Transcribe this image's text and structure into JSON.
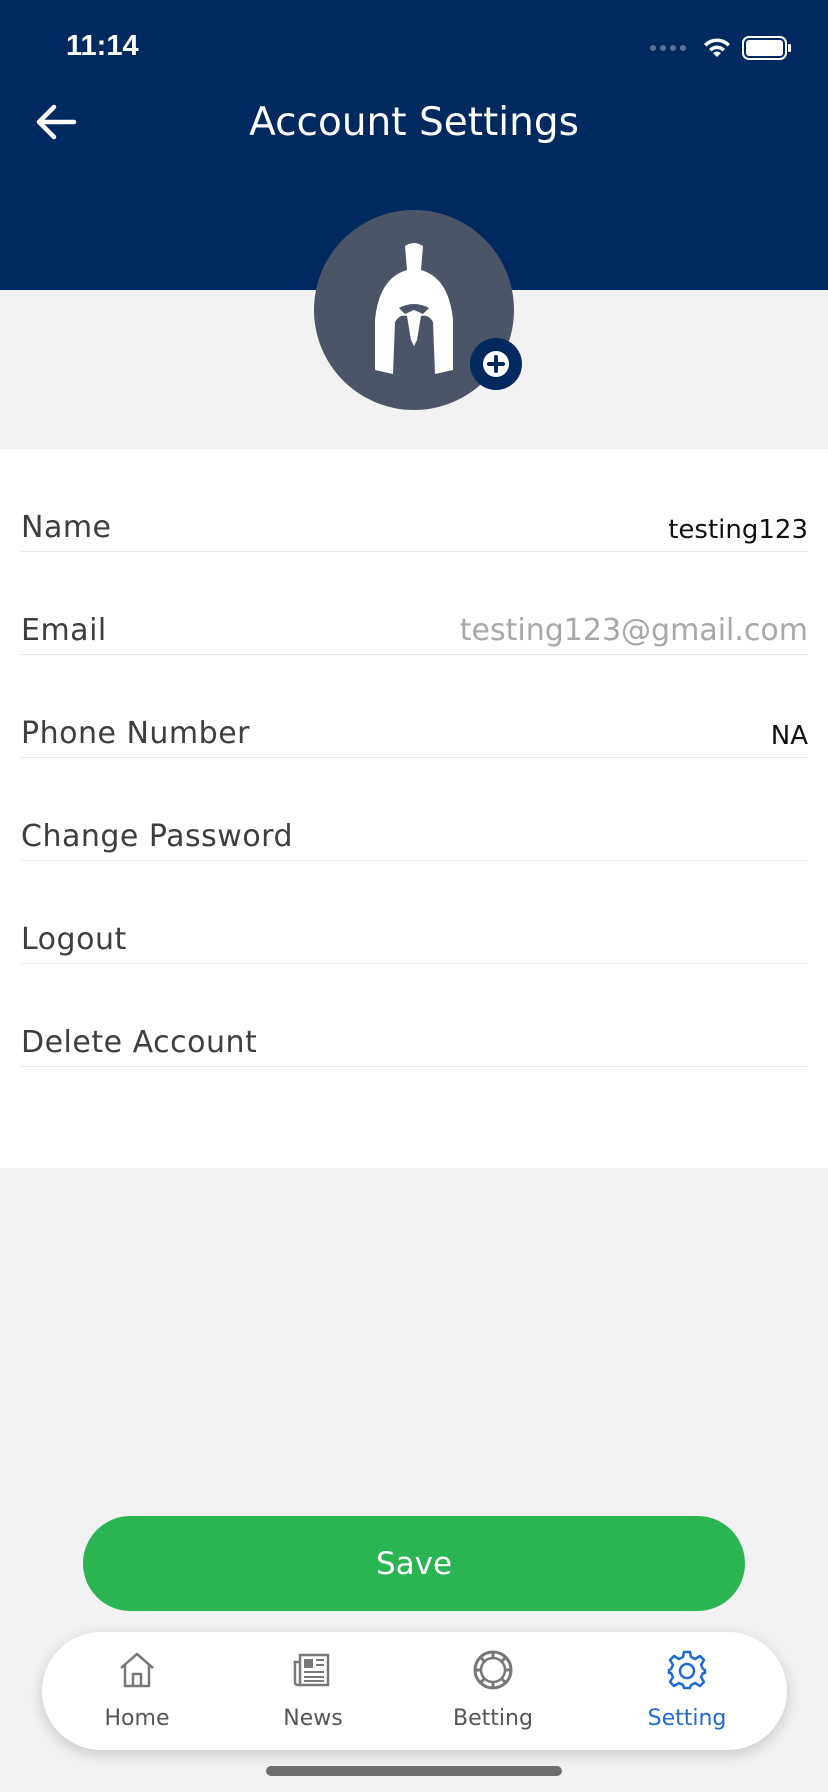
{
  "status_bar": {
    "time": "11:14"
  },
  "header": {
    "title": "Account Settings"
  },
  "profile": {
    "avatar_icon": "spartan-helmet-icon",
    "add_icon": "plus-icon"
  },
  "settings_rows": [
    {
      "label": "Name",
      "value": "testing123"
    },
    {
      "label": "Email",
      "value": "testing123@gmail.com"
    },
    {
      "label": "Phone Number",
      "value": "NA"
    },
    {
      "label": "Change Password"
    },
    {
      "label": "Logout"
    },
    {
      "label": "Delete Account"
    }
  ],
  "save_button": {
    "label": "Save",
    "color": "#2ab452"
  },
  "tab_bar": {
    "tabs": [
      {
        "label": "Home",
        "icon": "home-icon"
      },
      {
        "label": "News",
        "icon": "newspaper-icon"
      },
      {
        "label": "Betting",
        "icon": "chip-icon"
      },
      {
        "label": "Setting",
        "icon": "gear-icon",
        "active": true
      }
    ],
    "active_color": "#1e6bd6"
  },
  "colors": {
    "header_bg": "#002a5f",
    "page_bg": "#f2f2f3"
  }
}
